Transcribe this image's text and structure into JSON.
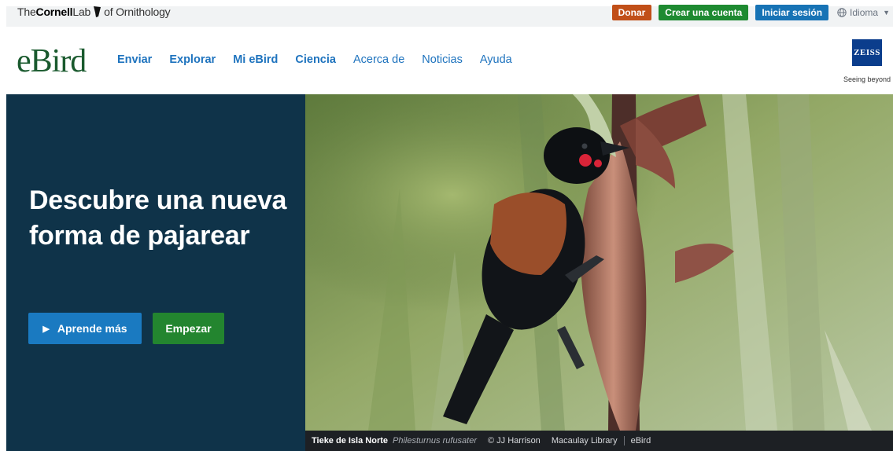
{
  "utility": {
    "cornell_the": "The",
    "cornell_name": "Cornell",
    "cornell_lab": "Lab",
    "cornell_of": "of Ornithology",
    "donate_label": "Donar",
    "create_account_label": "Crear una cuenta",
    "signin_label": "Iniciar sesión",
    "language_label": "Idioma"
  },
  "nav": {
    "logo": "eBird",
    "items": [
      {
        "label": "Enviar"
      },
      {
        "label": "Explorar"
      },
      {
        "label": "Mi eBird"
      },
      {
        "label": "Ciencia"
      },
      {
        "label": "Acerca de"
      },
      {
        "label": "Noticias"
      },
      {
        "label": "Ayuda"
      }
    ],
    "sponsor_badge": "ZEISS",
    "sponsor_tagline": "Seeing beyond"
  },
  "hero": {
    "title": "Descubre una nueva forma de pajarear",
    "learn_more_label": "Aprende más",
    "start_label": "Empezar"
  },
  "caption": {
    "species": "Tieke de Isla Norte",
    "scientific_name": "Philesturnus rufusater",
    "credit": "© JJ Harrison",
    "library": "Macaulay Library",
    "source": "eBird"
  },
  "colors": {
    "hero_panel": "#0f3349",
    "link_blue": "#1e73be",
    "donate": "#c14f18",
    "create": "#1e8a31",
    "signin": "#1773b5",
    "learn_more": "#1a7ac1",
    "start": "#23852f"
  }
}
